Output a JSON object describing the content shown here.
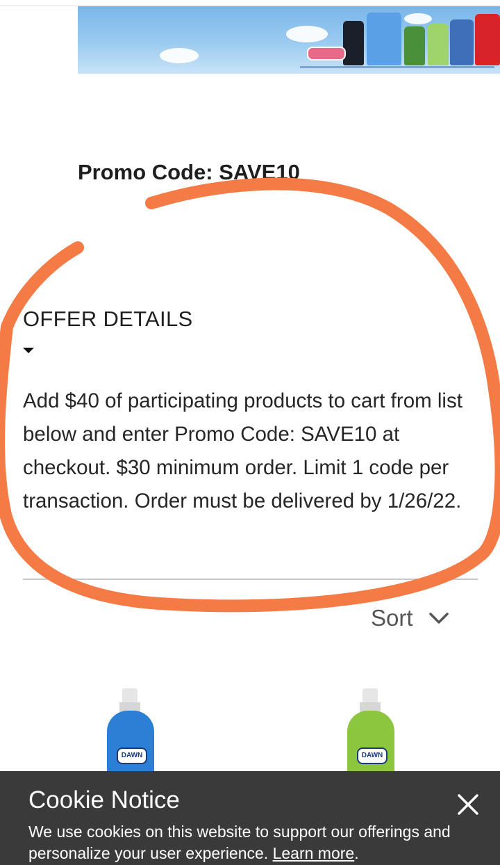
{
  "promo": {
    "label": "Promo Code: SAVE10"
  },
  "offer": {
    "title": "OFFER DETAILS",
    "details": "Add $40 of participating products to cart from list below and enter Promo Code: SAVE10 at checkout. $30 minimum order. Limit 1 code per transaction. Order must be delivered by 1/26/22."
  },
  "sort": {
    "label": "Sort"
  },
  "products": [
    {
      "brand": "DAWN",
      "color": "#2d7fd6"
    },
    {
      "brand": "DAWN",
      "color": "#8cc63f"
    }
  ],
  "cookie": {
    "title": "Cookie Notice",
    "text": "We use cookies on this website to support our offerings and personalize your user experience. ",
    "link": "Learn more",
    "suffix": "."
  },
  "annotation_color": "#f47b45",
  "icons": {
    "sort": "chevron-down-icon",
    "close": "close-icon",
    "offer_toggle": "caret-down-icon"
  }
}
